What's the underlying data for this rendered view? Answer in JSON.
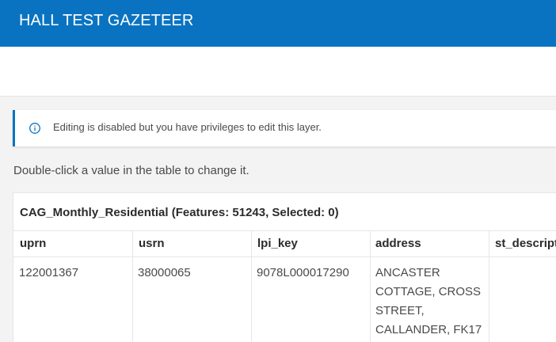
{
  "header": {
    "title": "HALL TEST GAZETEER"
  },
  "notice": {
    "icon": "info-icon",
    "text": "Editing is disabled but you have privileges to edit this layer."
  },
  "hint": {
    "text": "Double-click a value in the table to change it."
  },
  "table": {
    "title": "CAG_Monthly_Residential (Features: 51243, Selected: 0)",
    "columns": [
      "uprn",
      "usrn",
      "lpi_key",
      "address",
      "st_descript"
    ],
    "rows": [
      {
        "uprn": "122001367",
        "usrn": "38000065",
        "lpi_key": "9078L000017290",
        "address": "ANCASTER COTTAGE, CROSS STREET, CALLANDER, FK17",
        "st_descript": ""
      }
    ]
  },
  "colors": {
    "accent": "#0a73c1",
    "background": "#f3f3f3",
    "text": "#4a4a4a"
  }
}
